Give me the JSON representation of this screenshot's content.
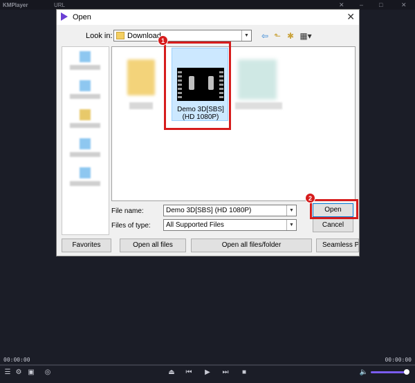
{
  "player": {
    "title": "KMPlayer",
    "url_label": "URL",
    "time_elapsed": "00:00:00",
    "time_total": "00:00:00",
    "volume_level": 0.95
  },
  "dialog": {
    "title": "Open",
    "look_in_label": "Look in:",
    "look_in_value": "Download",
    "selected_file_name": "Demo 3D[SBS] (HD 1080P)",
    "file_name_label": "File name:",
    "file_name_value": "Demo 3D[SBS] (HD  1080P)",
    "files_of_type_label": "Files of type:",
    "files_of_type_value": "All Supported Files",
    "open_button": "Open",
    "cancel_button": "Cancel",
    "favorites_button": "Favorites",
    "open_all_files_button": "Open all files",
    "open_all_folder_button": "Open all files/folder",
    "seamless_button": "Seamless Play"
  },
  "annotations": {
    "step1": "1",
    "step2": "2",
    "color": "#d61c1c"
  },
  "icons": [
    "back-arrow-icon",
    "up-folder-icon",
    "new-folder-icon",
    "view-menu-icon",
    "folder-icon",
    "video-file-icon",
    "close-icon"
  ]
}
